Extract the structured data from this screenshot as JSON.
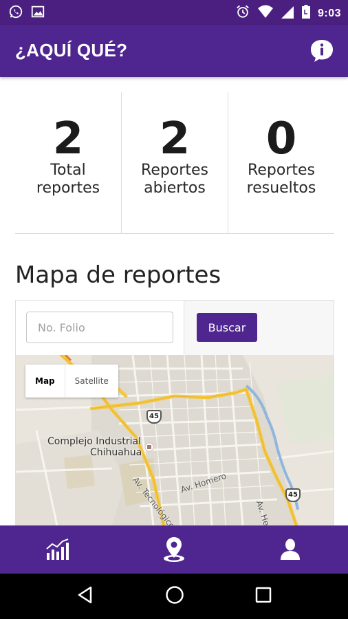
{
  "status_bar": {
    "time": "9:03",
    "left_icons": [
      "whatsapp-icon",
      "image-icon"
    ],
    "right_icons": [
      "alarm-icon",
      "wifi-icon",
      "signal-icon",
      "battery-icon"
    ]
  },
  "app_bar": {
    "title": "¿AQUÍ QUÉ?",
    "info_icon": "info-icon"
  },
  "stats": [
    {
      "value": "2",
      "label_line1": "Total",
      "label_line2": "reportes"
    },
    {
      "value": "2",
      "label_line1": "Reportes",
      "label_line2": "abiertos"
    },
    {
      "value": "0",
      "label_line1": "Reportes",
      "label_line2": "resueltos"
    }
  ],
  "map_section": {
    "title": "Mapa de reportes",
    "search": {
      "placeholder": "No. Folio",
      "value": "",
      "button_label": "Buscar"
    },
    "map_type": {
      "map_label": "Map",
      "satellite_label": "Satellite",
      "selected": "Map"
    },
    "labels": {
      "place_line1": "Complejo Industrial",
      "place_line2": "Chihuahua",
      "road_tecnologico": "Av. Tecnológico",
      "road_homero": "Av. Homero",
      "road_heroes": "Av. Hero",
      "highway_1": "45",
      "highway_2": "45"
    }
  },
  "bottom_nav": {
    "tabs": [
      {
        "name": "stats",
        "icon": "chart-icon"
      },
      {
        "name": "map",
        "icon": "location-pin-icon"
      },
      {
        "name": "profile",
        "icon": "user-icon"
      }
    ]
  },
  "colors": {
    "primary": "#4f2690",
    "status_bar": "#4a1f80",
    "map_bg": "#e9e5dc",
    "highway": "#f5c842"
  }
}
